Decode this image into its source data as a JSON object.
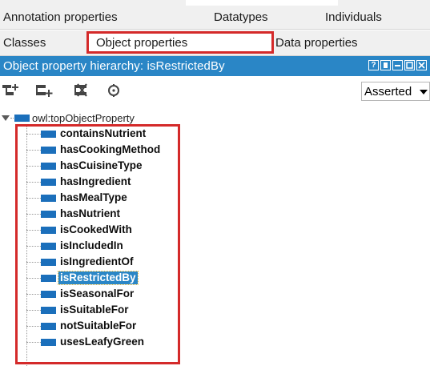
{
  "tabs_row1": {
    "annotation": "Annotation properties",
    "datatypes": "Datatypes",
    "individuals": "Individuals"
  },
  "tabs_row2": {
    "classes": "Classes",
    "object_properties": "Object properties",
    "data_properties": "Data properties"
  },
  "view": {
    "title": "Object property hierarchy: isRestrictedBy",
    "controls": [
      "help",
      "pin",
      "minimize",
      "maximize",
      "close"
    ]
  },
  "toolbar": {
    "icons": [
      "add-sub-property-icon",
      "add-sibling-property-icon",
      "delete-property-icon",
      "find-usage-icon"
    ],
    "mode_select": "Asserted"
  },
  "tree": {
    "root": "owl:topObjectProperty",
    "children": [
      "containsNutrient",
      "hasCookingMethod",
      "hasCuisineType",
      "hasIngredient",
      "hasMealType",
      "hasNutrient",
      "isCookedWith",
      "isIncludedIn",
      "isIngredientOf",
      "isRestrictedBy",
      "isSeasonalFor",
      "isSuitableFor",
      "notSuitableFor",
      "usesLeafyGreen"
    ],
    "selected": "isRestrictedBy"
  },
  "colors": {
    "accent_blue": "#2a86c6",
    "property_icon": "#1b6fbb",
    "highlight_red": "#d42a2a"
  }
}
